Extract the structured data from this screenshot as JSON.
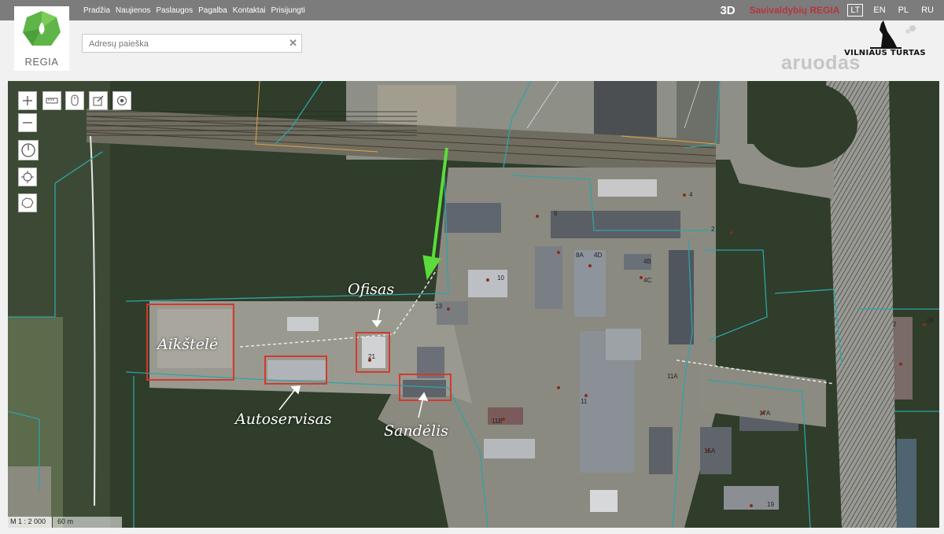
{
  "nav": {
    "items": [
      "Pradžia",
      "Naujienos",
      "Paslaugos",
      "Pagalba",
      "Kontaktai",
      "Prisijungti"
    ]
  },
  "topright": {
    "view3d": "3D",
    "title": "Savivaldybių REGIA",
    "languages": [
      "LT",
      "EN",
      "PL",
      "RU"
    ],
    "selected_language": "LT"
  },
  "logo": {
    "text": "REGIA"
  },
  "search": {
    "placeholder": "Adresų paieška",
    "value": ""
  },
  "partner": {
    "name": "VILNIAUS TURTAS"
  },
  "watermark": {
    "text": "aruodas"
  },
  "map": {
    "scale_ratio": "M 1 : 2 000",
    "scale_bar": "60 m",
    "annotations": {
      "parking": "Aikštelė",
      "office": "Ofisas",
      "car_service": "Autoservisas",
      "warehouse": "Sandėlis"
    },
    "building_numbers": [
      "6",
      "4",
      "2",
      "10",
      "8A",
      "4D",
      "4B",
      "4C",
      "13",
      "21",
      "11A",
      "11",
      "11B",
      "15A",
      "17A",
      "19",
      "2",
      "2K"
    ],
    "colors": {
      "highlight_box": "#d23a2e",
      "arrow": "#5bdc3a",
      "parcel_lines": "#2fa3a8"
    }
  },
  "toolbar": {
    "icons": [
      "zoom-in-icon",
      "zoom-out-icon",
      "measure-icon",
      "mouse-icon",
      "edit-icon",
      "target-icon",
      "compass-icon",
      "locate-icon",
      "map-outline-icon"
    ]
  }
}
